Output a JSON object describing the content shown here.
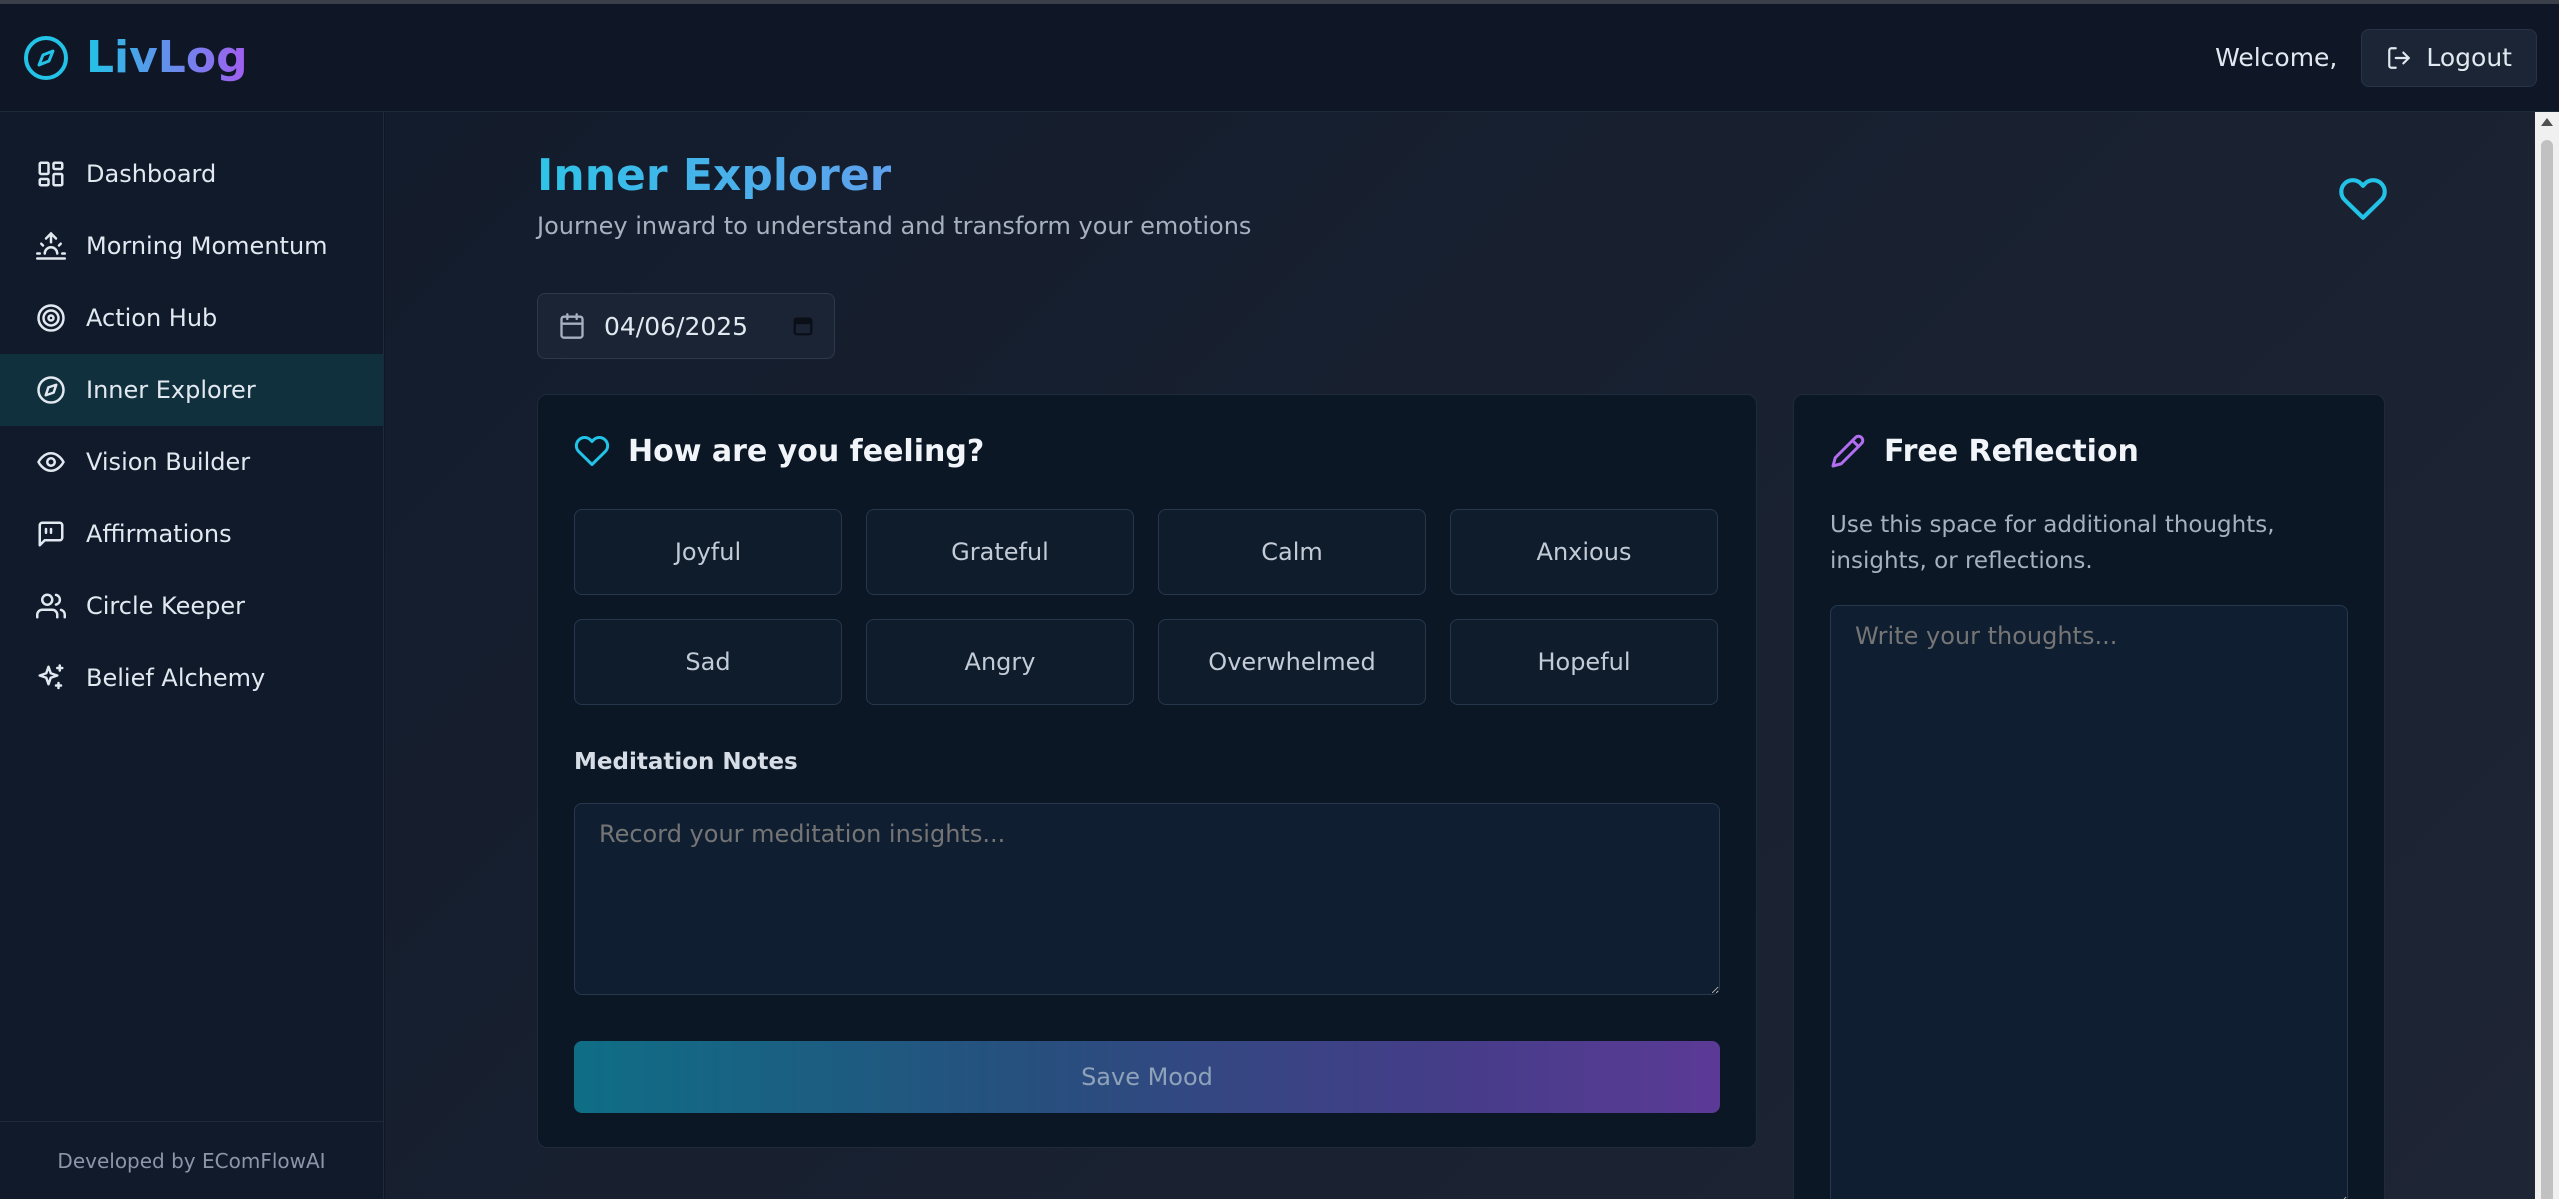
{
  "app": {
    "name": "LivLog",
    "brand_gradient": [
      "#22c3e6",
      "#a35cf0"
    ],
    "accent_cyan": "#22c3e6",
    "accent_purple": "#b26ef0"
  },
  "header": {
    "welcome_text": "Welcome,",
    "logout_label": "Logout"
  },
  "sidebar": {
    "items": [
      {
        "label": "Dashboard",
        "icon": "dashboard-icon"
      },
      {
        "label": "Morning Momentum",
        "icon": "sunrise-icon"
      },
      {
        "label": "Action Hub",
        "icon": "target-icon"
      },
      {
        "label": "Inner Explorer",
        "icon": "compass-icon",
        "active": true
      },
      {
        "label": "Vision Builder",
        "icon": "eye-icon"
      },
      {
        "label": "Affirmations",
        "icon": "message-quote-icon"
      },
      {
        "label": "Circle Keeper",
        "icon": "users-icon"
      },
      {
        "label": "Belief Alchemy",
        "icon": "sparkles-icon"
      }
    ],
    "footer": "Developed by EComFlowAI"
  },
  "page": {
    "title": "Inner Explorer",
    "subtitle": "Journey inward to understand and transform your emotions",
    "date_value": "04/06/2025"
  },
  "mood_card": {
    "title": "How are you feeling?",
    "moods": [
      "Joyful",
      "Grateful",
      "Calm",
      "Anxious",
      "Sad",
      "Angry",
      "Overwhelmed",
      "Hopeful"
    ],
    "notes_label": "Meditation Notes",
    "notes_placeholder": "Record your meditation insights...",
    "save_label": "Save Mood"
  },
  "reflection_card": {
    "title": "Free Reflection",
    "description": "Use this space for additional thoughts, insights, or reflections.",
    "placeholder": "Write your thoughts..."
  }
}
